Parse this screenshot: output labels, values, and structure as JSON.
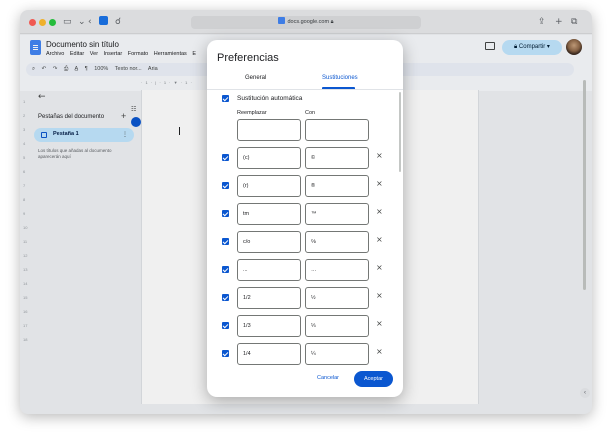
{
  "browser": {
    "url": "docs.google.com"
  },
  "docs": {
    "title": "Documento sin título",
    "menu": [
      "Archivo",
      "Editar",
      "Ver",
      "Insertar",
      "Formato",
      "Herramientas",
      "E"
    ],
    "toolbar": {
      "zoom": "100%",
      "style": "Texto nor...",
      "font": "Aria"
    },
    "share_label": "Compartir",
    "ruler_marks": "· 1 · | · 1 · ▼ · 1 ·",
    "left_ruler": [
      "1",
      "2",
      "3",
      "4",
      "5",
      "6",
      "7",
      "8",
      "9",
      "10",
      "11",
      "12",
      "13",
      "14",
      "15",
      "16",
      "17",
      "18"
    ]
  },
  "sidebar": {
    "title": "Pestañas del documento",
    "add": "+",
    "tab_label": "Pestaña 1",
    "tab_more": "⋮",
    "note": "Los títulos que añadas al documento aparecerán aquí"
  },
  "dialog": {
    "title": "Preferencias",
    "tabs": [
      "General",
      "Sustituciones"
    ],
    "active_tab": "Sustituciones",
    "auto_label": "Sustitución automática",
    "col_replace": "Reemplazar",
    "col_with": "Con",
    "new_row": {
      "replace": "",
      "with": ""
    },
    "rows": [
      {
        "replace": "(c)",
        "with": "©"
      },
      {
        "replace": "(r)",
        "with": "®"
      },
      {
        "replace": "tm",
        "with": "™"
      },
      {
        "replace": "c/o",
        "with": "℅"
      },
      {
        "replace": "...",
        "with": "…"
      },
      {
        "replace": "1/2",
        "with": "½"
      },
      {
        "replace": "1/3",
        "with": "⅓"
      },
      {
        "replace": "1/4",
        "with": "¼"
      }
    ],
    "remove_icon": "×",
    "cancel_label": "Cancelar",
    "accept_label": "Aceptar"
  },
  "colors": {
    "accent": "#0b57d0",
    "share_bg": "#c2e7ff"
  }
}
